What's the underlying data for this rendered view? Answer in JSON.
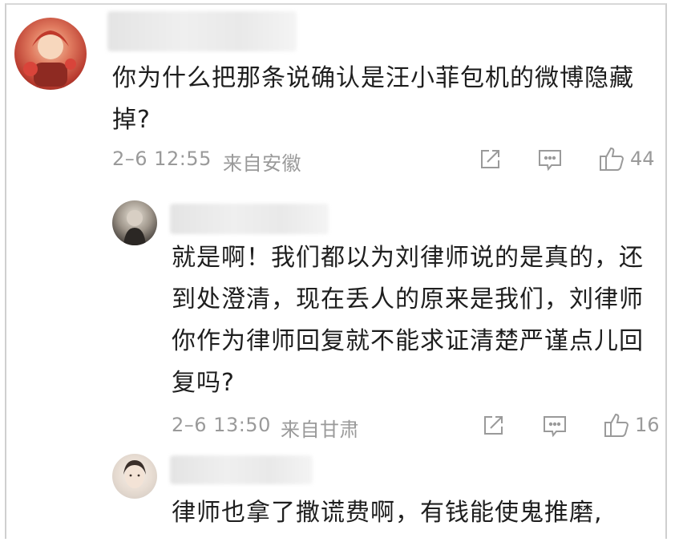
{
  "comments": [
    {
      "text": "你为什么把那条说确认是汪小菲包机的微博隐藏掉?",
      "time": "2–6 12:55",
      "location": "来自安徽",
      "likes": "44",
      "avatar_icon": "red-anime-avatar"
    },
    {
      "text": "就是啊！我们都以为刘律师说的是真的，还到处澄清，现在丢人的原来是我们，刘律师你作为律师回复就不能求证清楚严谨点儿回复吗?",
      "time": "2–6 13:50",
      "location": "来自甘肃",
      "likes": "16",
      "avatar_icon": "dark-portrait-avatar"
    },
    {
      "text": "律师也拿了撒谎费啊，有钱能使鬼推磨,",
      "avatar_icon": "face-portrait-avatar"
    }
  ],
  "icons": {
    "share": "share-icon",
    "comment": "comment-icon",
    "like": "thumbs-up-icon"
  },
  "colors": {
    "meta_text": "#9a9a9a",
    "body_text": "#1e1e1e"
  }
}
